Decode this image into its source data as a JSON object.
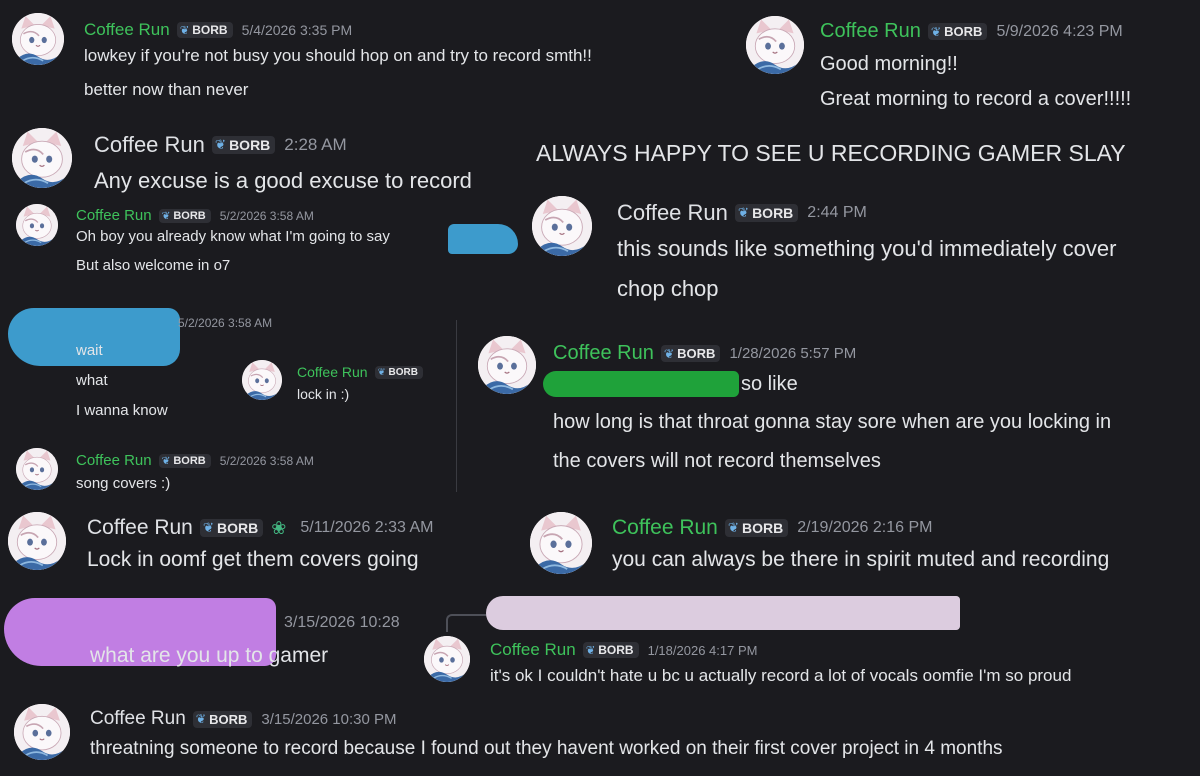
{
  "user": {
    "name": "Coffee Run",
    "tag": "BORB"
  },
  "colors": {
    "name": "#3ec25b",
    "background": "#1b1b1f",
    "redact_blue": "#3d9bcc",
    "redact_green": "#1fa23a",
    "redact_purple": "#c17ee3",
    "redact_lavender": "#dcccdf"
  },
  "messages": {
    "m1": {
      "timestamp": "5/4/2026 3:35 PM",
      "lines": [
        "lowkey if you're not busy you should hop on and try to record smth!!",
        "better now than never"
      ]
    },
    "m2": {
      "timestamp": "5/9/2026 4:23 PM",
      "lines": [
        "Good morning!!",
        "Great morning to record a cover!!!!!"
      ]
    },
    "m3": {
      "timestamp": "2:28 AM",
      "lines": [
        "Any excuse is a good excuse to record"
      ]
    },
    "m4": {
      "lines": [
        "ALWAYS HAPPY TO SEE U RECORDING GAMER SLAY"
      ]
    },
    "m5": {
      "timestamp": "5/2/2026 3:58 AM",
      "lines": [
        "Oh boy you already know what I'm going to say",
        "But also welcome in o7"
      ]
    },
    "m6": {
      "timestamp": "2:44 PM",
      "lines": [
        "this sounds like something you'd immediately cover",
        "chop chop"
      ]
    },
    "m7": {
      "timestamp": "5/2/2026 3:58 AM",
      "lines": [
        "wait",
        "what",
        "I wanna know"
      ]
    },
    "m8": {
      "lines": [
        "lock in :)"
      ]
    },
    "m9": {
      "timestamp": "5/2/2026 3:58 AM",
      "lines": [
        "song covers :)"
      ]
    },
    "m10": {
      "timestamp": "1/28/2026 5:57 PM",
      "lines": [
        "so like",
        "how long is that throat gonna stay sore when are you locking in",
        "the covers will not record themselves"
      ]
    },
    "m11": {
      "timestamp": "5/11/2026 2:33 AM",
      "lines": [
        "Lock in oomf get them covers going"
      ]
    },
    "m12": {
      "timestamp": "2/19/2026 2:16 PM",
      "lines": [
        "you can always be there in spirit muted and recording"
      ]
    },
    "m13": {
      "timestamp": "3/15/2026 10:28",
      "lines": [
        "what are you up to gamer"
      ]
    },
    "m14": {
      "timestamp": "1/18/2026 4:17 PM",
      "lines": [
        "it's ok I couldn't hate u bc u actually record a lot of vocals oomfie I'm so proud"
      ]
    },
    "m15": {
      "timestamp": "3/15/2026 10:30 PM",
      "lines": [
        "threatning someone to record because I found out they havent worked on their first cover project in 4 months"
      ]
    }
  }
}
